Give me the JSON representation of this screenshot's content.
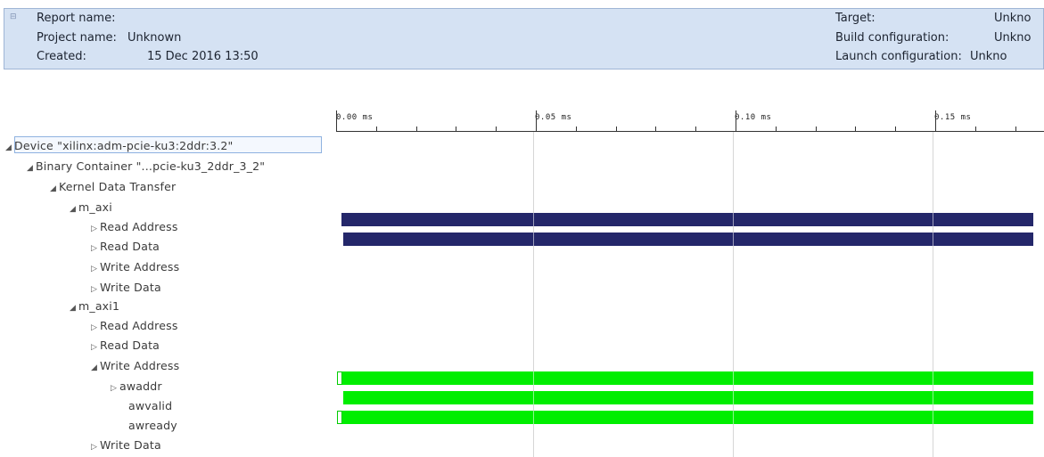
{
  "header": {
    "report_name_label": "Report name:",
    "report_name_value": "",
    "project_name_label": "Project name:",
    "project_name_value": "Unknown",
    "created_label": "Created:",
    "created_value": "15 Dec 2016 13:50",
    "target_label": "Target:",
    "target_value": "Unkno",
    "build_config_label": "Build configuration:",
    "build_config_value": "Unkno",
    "launch_config_label": "Launch configuration:",
    "launch_config_value": "Unkno"
  },
  "ruler": {
    "labels": [
      "0.00 ms",
      "0.05 ms",
      "0.10 ms",
      "0.15 ms"
    ]
  },
  "tree": [
    {
      "label": "Device \"xilinx:adm-pcie-ku3:2ddr:3.2\"",
      "arrow": "expanded"
    },
    {
      "label": "Binary Container \"...pcie-ku3_2ddr_3_2\"",
      "arrow": "expanded"
    },
    {
      "label": "Kernel Data Transfer",
      "arrow": "expanded"
    },
    {
      "label": "m_axi",
      "arrow": "expanded"
    },
    {
      "label": "Read Address",
      "arrow": "collapsed"
    },
    {
      "label": "Read Data",
      "arrow": "collapsed"
    },
    {
      "label": "Write Address",
      "arrow": "collapsed"
    },
    {
      "label": "Write Data",
      "arrow": "collapsed"
    },
    {
      "label": "m_axi1",
      "arrow": "expanded"
    },
    {
      "label": "Read Address",
      "arrow": "collapsed"
    },
    {
      "label": "Read Data",
      "arrow": "collapsed"
    },
    {
      "label": "Write Address",
      "arrow": "expanded"
    },
    {
      "label": "awaddr",
      "arrow": "collapsed"
    },
    {
      "label": "awvalid",
      "arrow": "none"
    },
    {
      "label": "awready",
      "arrow": "none"
    },
    {
      "label": "Write Data",
      "arrow": "collapsed"
    }
  ],
  "colors": {
    "header_bg": "#d5e2f3",
    "read_bar": "#24276a",
    "write_bar": "#00ee00",
    "selection_border": "#8fb2e0"
  },
  "icons": {
    "expanded": "triangle-down-icon",
    "collapsed": "triangle-right-icon",
    "header_toggle": "collapse-square-icon"
  }
}
